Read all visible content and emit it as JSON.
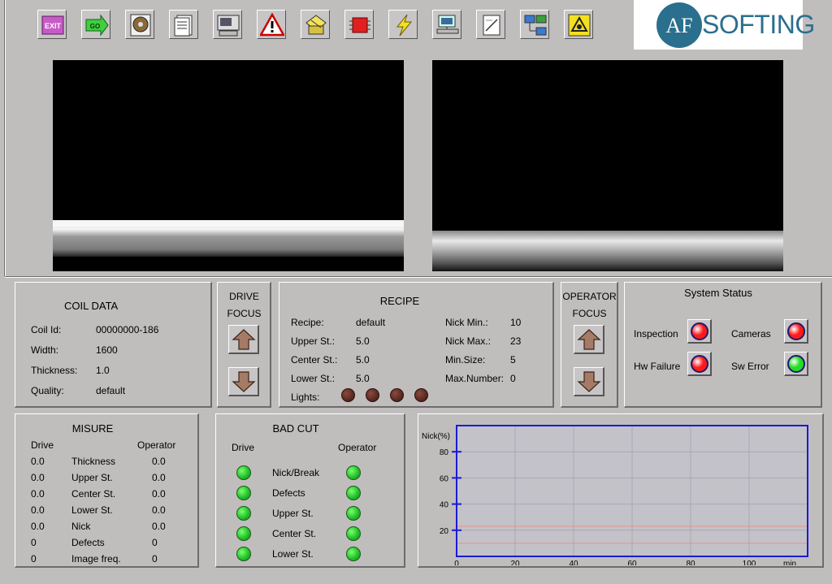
{
  "toolbar": [
    {
      "name": "exit-icon",
      "label": "EXIT",
      "color": "#c85ac8"
    },
    {
      "name": "go-icon",
      "label": "GO",
      "color": "#3fcf3f"
    },
    {
      "name": "disk-icon",
      "label": ""
    },
    {
      "name": "document-list-icon",
      "label": ""
    },
    {
      "name": "computer-panel-icon",
      "label": ""
    },
    {
      "name": "warning-icon",
      "label": ""
    },
    {
      "name": "tools-folder-icon",
      "label": ""
    },
    {
      "name": "chip-icon",
      "label": ""
    },
    {
      "name": "lightning-icon",
      "label": ""
    },
    {
      "name": "network-computer-icon",
      "label": ""
    },
    {
      "name": "edit-document-icon",
      "label": ""
    },
    {
      "name": "network-link-icon",
      "label": ""
    },
    {
      "name": "recycle-icon",
      "label": ""
    }
  ],
  "logo": {
    "mark": "AF",
    "text": "SOFTING",
    "color": "#2a6f8e"
  },
  "coil": {
    "title": "COIL DATA",
    "rows": [
      {
        "label": "Coil Id:",
        "value": "00000000-186"
      },
      {
        "label": "Width:",
        "value": "1600"
      },
      {
        "label": "Thickness:",
        "value": "1.0"
      },
      {
        "label": "Quality:",
        "value": "default"
      }
    ]
  },
  "drive_focus": {
    "line1": "DRIVE",
    "line2": "FOCUS"
  },
  "operator_focus": {
    "line1": "OPERATOR",
    "line2": "FOCUS"
  },
  "recipe": {
    "title": "RECIPE",
    "left": [
      {
        "label": "Recipe:",
        "value": "default"
      },
      {
        "label": "Upper St.:",
        "value": "5.0"
      },
      {
        "label": "Center St.:",
        "value": "5.0"
      },
      {
        "label": "Lower St.:",
        "value": "5.0"
      }
    ],
    "right": [
      {
        "label": "Nick Min.:",
        "value": "10"
      },
      {
        "label": "Nick Max.:",
        "value": "23"
      },
      {
        "label": "Min.Size:",
        "value": "5"
      },
      {
        "label": "Max.Number:",
        "value": "0"
      }
    ],
    "lights_label": "Lights:"
  },
  "status": {
    "title": "System Status",
    "items": [
      {
        "label": "Inspection",
        "color": "#ff1a1a"
      },
      {
        "label": "Cameras",
        "color": "#ff1a1a"
      },
      {
        "label": "Hw Failure",
        "color": "#ff1a1a"
      },
      {
        "label": "Sw Error",
        "color": "#22dd22"
      }
    ]
  },
  "misure": {
    "title": "MISURE",
    "col_drive": "Drive",
    "col_operator": "Operator",
    "rows": [
      {
        "drive": "0.0",
        "name": "Thickness",
        "operator": "0.0"
      },
      {
        "drive": "0.0",
        "name": "Upper St.",
        "operator": "0.0"
      },
      {
        "drive": "0.0",
        "name": "Center St.",
        "operator": "0.0"
      },
      {
        "drive": "0.0",
        "name": "Lower St.",
        "operator": "0.0"
      },
      {
        "drive": "0.0",
        "name": "Nick",
        "operator": "0.0"
      },
      {
        "drive": "0",
        "name": "Defects",
        "operator": "0"
      },
      {
        "drive": "0",
        "name": "Image freq.",
        "operator": "0"
      }
    ]
  },
  "badcut": {
    "title": "BAD CUT",
    "col_drive": "Drive",
    "col_operator": "Operator",
    "rows": [
      "Nick/Break",
      "Defects",
      "Upper St.",
      "Center St.",
      "Lower St."
    ]
  },
  "chart_data": {
    "type": "line",
    "ylabel": "Nick(%)",
    "xlabel": "min",
    "xlim": [
      0,
      120
    ],
    "ylim": [
      0,
      100
    ],
    "xticks": [
      0,
      20,
      40,
      60,
      80,
      100
    ],
    "yticks": [
      20,
      40,
      60,
      80
    ],
    "grid": true,
    "hlines": [
      {
        "y": 23,
        "color": "#e89090"
      },
      {
        "y": 10,
        "color": "#e89090"
      }
    ],
    "series": []
  }
}
